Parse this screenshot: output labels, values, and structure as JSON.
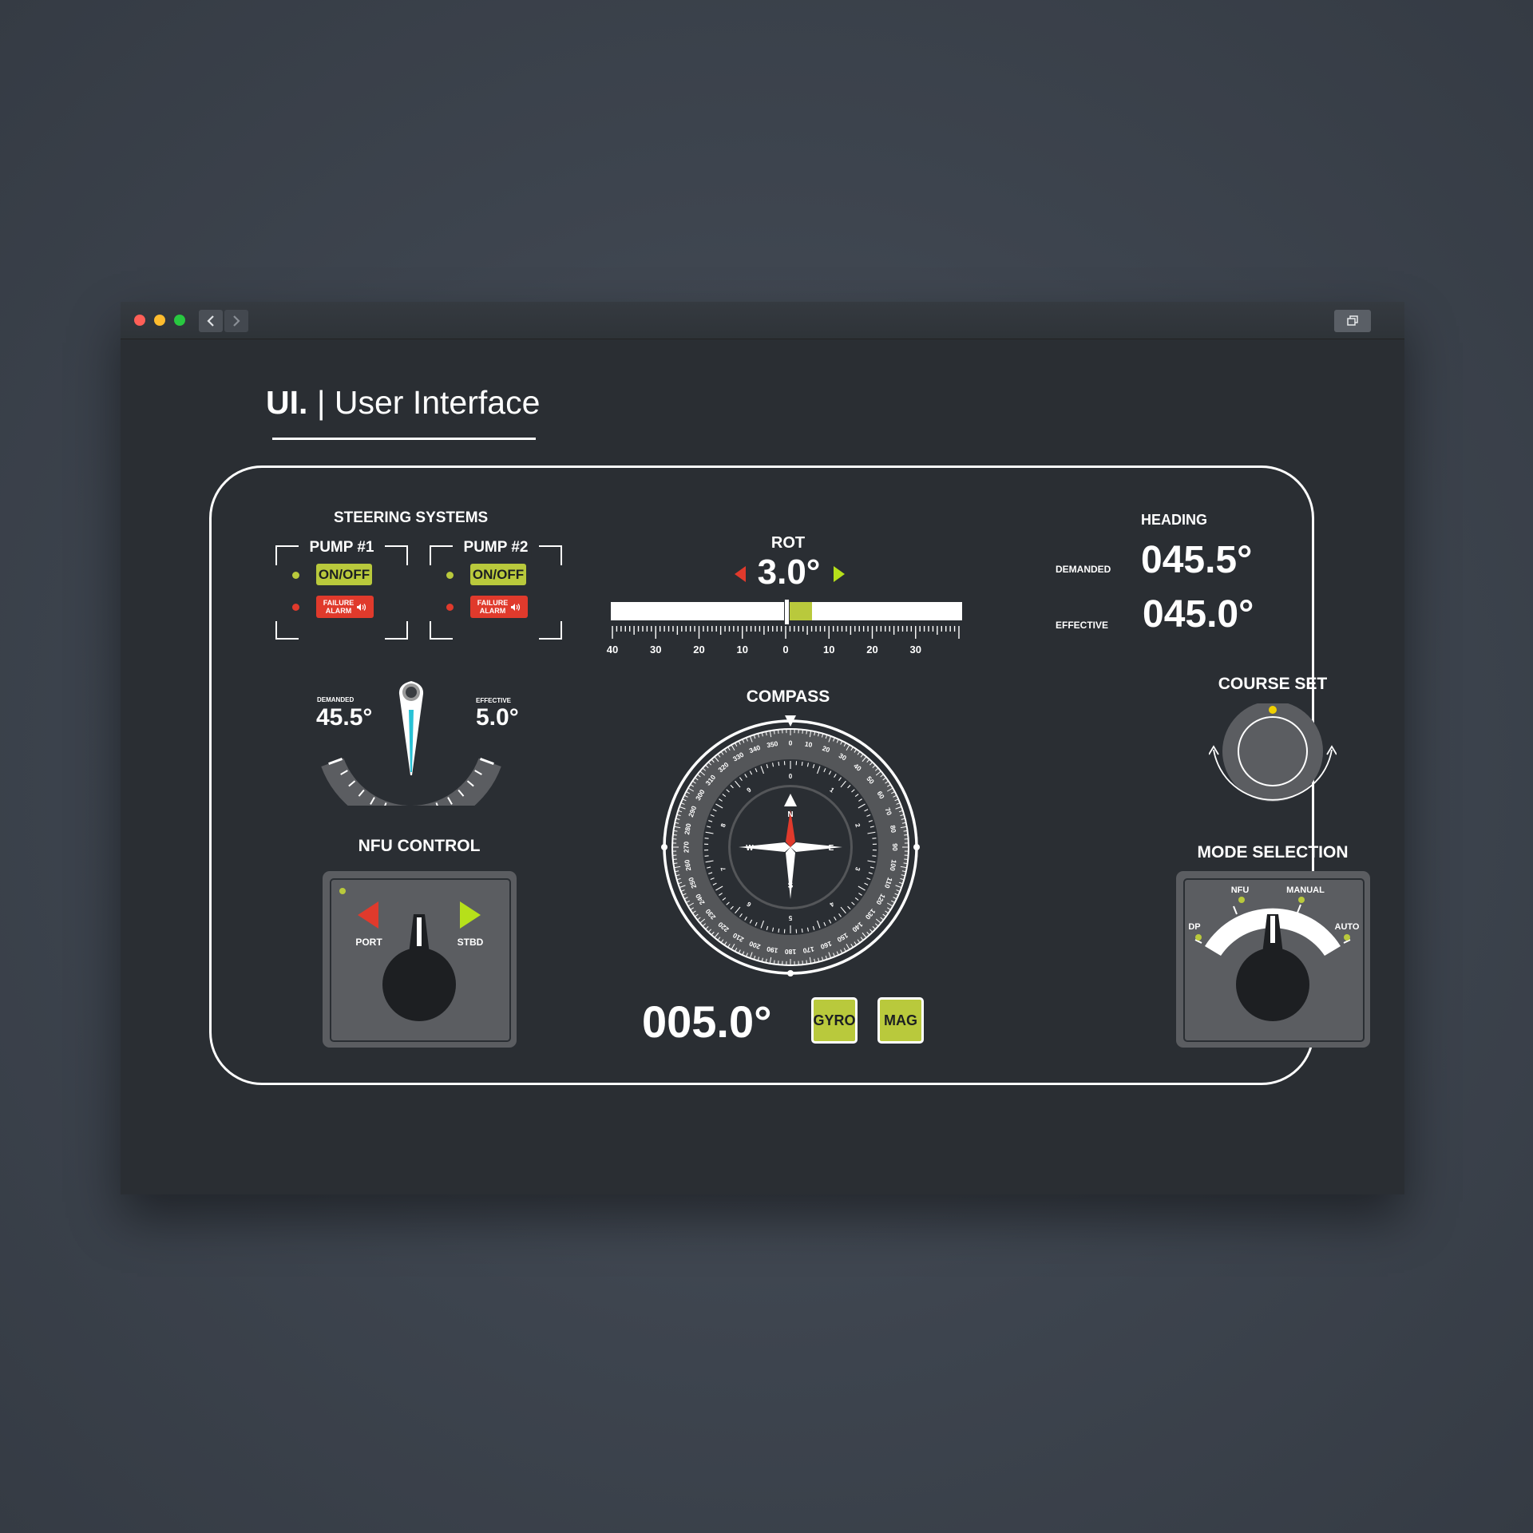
{
  "window": {
    "dots": [
      "#ff5f57",
      "#febc2e",
      "#28c840"
    ],
    "back_icon": "chevron-left-icon",
    "forward_icon": "chevron-right-icon",
    "restore_icon": "window-restore-icon"
  },
  "header": {
    "brand": "UI.",
    "separator": "|",
    "title": "User Interface"
  },
  "steering": {
    "title": "STEERING SYSTEMS",
    "pumps": [
      {
        "label": "PUMP  #1",
        "onoff": "ON/OFF",
        "failure_line1": "FAILURE",
        "failure_line2": "ALARM"
      },
      {
        "label": "PUMP  #2",
        "onoff": "ON/OFF",
        "failure_line1": "FAILURE",
        "failure_line2": "ALARM"
      }
    ]
  },
  "rudder": {
    "demanded_label": "DEMANDED",
    "demanded_value": "45.5°",
    "effective_label": "EFFECTIVE",
    "effective_value": "5.0°"
  },
  "rot": {
    "title": "ROT",
    "value": "3.0°",
    "scale_labels": [
      "40",
      "30",
      "20",
      "10",
      "0",
      "10",
      "20",
      "30"
    ],
    "indicator_start": 0,
    "indicator_end": 6
  },
  "heading": {
    "title": "HEADING",
    "demanded_label": "DEMANDED",
    "demanded_value": "045.5°",
    "effective_label": "EFFECTIVE",
    "effective_value": "045.0°"
  },
  "course_set": {
    "title": "COURSE SET"
  },
  "compass": {
    "title": "COMPASS",
    "cardinals": {
      "n": "N",
      "e": "E",
      "s": "S",
      "w": "W"
    },
    "readout": "005.0°",
    "gyro_label": "GYRO",
    "mag_label": "MAG"
  },
  "nfu": {
    "title": "NFU CONTROL",
    "port_label": "PORT",
    "stbd_label": "STBD"
  },
  "mode": {
    "title": "MODE SELECTION",
    "options": [
      "DP",
      "NFU",
      "MANUAL",
      "AUTO"
    ]
  },
  "colors": {
    "accent_green": "#b9c93c",
    "alarm_red": "#e03a2c",
    "port_red": "#e03a2c",
    "stbd_green": "#b6e01a",
    "needle_cyan": "#29c2d6",
    "course_dot": "#f0d000"
  }
}
